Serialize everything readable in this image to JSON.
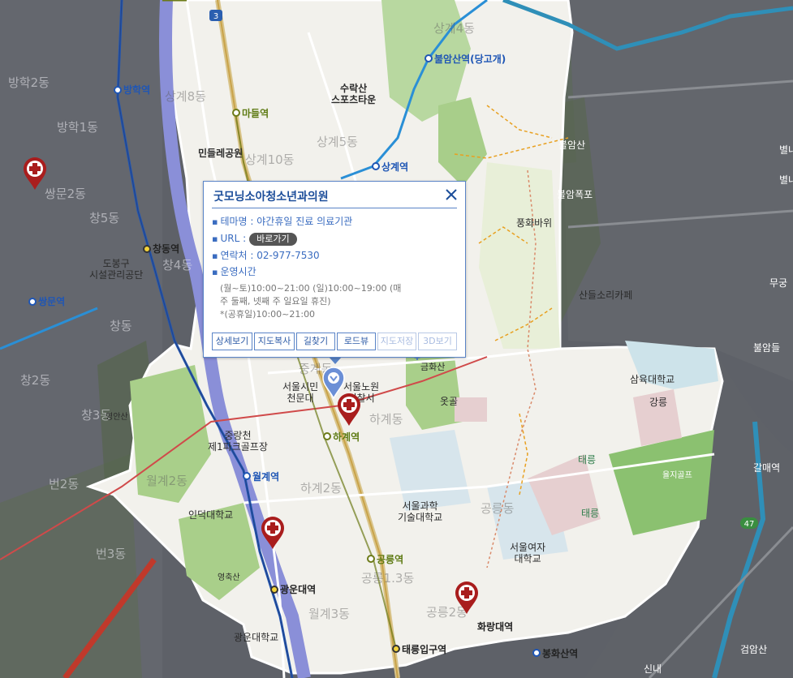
{
  "colors": {
    "outside": "#5e6168",
    "district": "#f3f2ee",
    "park": "#a9cf8a",
    "river": "#8a8fd8",
    "subway1": "#1f56b5",
    "subway7": "#6c7a18",
    "rail": "#c9a34a",
    "hospital": "#a91d1d",
    "popup_border": "#5a84c7"
  },
  "map": {
    "labels_outside": [
      {
        "text": "방학2동"
      },
      {
        "text": "방학1동"
      },
      {
        "text": "쌍문2동"
      },
      {
        "text": "창5동"
      },
      {
        "text": "창4동"
      },
      {
        "text": "창동"
      },
      {
        "text": "창2동"
      },
      {
        "text": "창3동"
      },
      {
        "text": "번2동"
      },
      {
        "text": "번3동"
      },
      {
        "text": "불암폭포"
      },
      {
        "text": "별내"
      },
      {
        "text": "별내"
      },
      {
        "text": "무궁"
      },
      {
        "text": "불암들"
      },
      {
        "text": "갈매역"
      },
      {
        "text": "검암산"
      },
      {
        "text": "불암산"
      },
      {
        "text": "신내"
      }
    ],
    "stations": [
      {
        "text": "방학역"
      },
      {
        "text": "창동역"
      },
      {
        "text": "쌍문역"
      },
      {
        "text": "불암산역(당고개)"
      },
      {
        "text": "상계역"
      },
      {
        "text": "마들역"
      },
      {
        "text": "하계역"
      },
      {
        "text": "월계역"
      },
      {
        "text": "공릉역"
      },
      {
        "text": "광운대역"
      },
      {
        "text": "태릉입구역"
      },
      {
        "text": "화랑대역"
      },
      {
        "text": "봉화산역"
      }
    ],
    "pois": [
      {
        "text": "수락산\n스포츠타운"
      },
      {
        "text": "민들레공원"
      },
      {
        "text": "도봉구\n시설관리공단"
      },
      {
        "text": "서울시민\n천문대"
      },
      {
        "text": "서울노원\n경찰서"
      },
      {
        "text": "중랑천\n제1파크골프장"
      },
      {
        "text": "인덕대학교"
      },
      {
        "text": "서울과학\n기술대학교"
      },
      {
        "text": "서울여자\n대학교"
      },
      {
        "text": "삼육대학교"
      },
      {
        "text": "광운대학교"
      },
      {
        "text": "산들소리카페"
      },
      {
        "text": "풍화바위"
      },
      {
        "text": "금화산"
      },
      {
        "text": "옷골"
      },
      {
        "text": "강릉"
      },
      {
        "text": "태릉"
      },
      {
        "text": "태릉"
      },
      {
        "text": "영축산"
      },
      {
        "text": "영안산"
      },
      {
        "text": "율지골프"
      }
    ],
    "districts": [
      {
        "text": "상계4동"
      },
      {
        "text": "상계8동"
      },
      {
        "text": "상계5동"
      },
      {
        "text": "상계10동"
      },
      {
        "text": "하계동"
      },
      {
        "text": "하계2동"
      },
      {
        "text": "월계2동"
      },
      {
        "text": "월계3동"
      },
      {
        "text": "공릉동"
      },
      {
        "text": "공릉1.3동"
      },
      {
        "text": "공릉2동"
      },
      {
        "text": "중계동"
      }
    ],
    "road_numbers": [
      "3",
      "47"
    ]
  },
  "popup": {
    "title": "굿모닝소아청소년과의원",
    "theme_label": "테마명 : 야간휴일 진료 의료기관",
    "url_label": "URL :",
    "url_button": "바로가기",
    "contact_label": "연락처 : 02-977-7530",
    "hours_label": "운영시간",
    "hours_line1": "(월~토)10:00~21:00 (일)10:00~19:00 (매",
    "hours_line2": "주 둘째, 넷째 주 일요일 휴진)",
    "hours_line3": "*(공휴일)10:00~21:00",
    "buttons": [
      "상세보기",
      "지도복사",
      "길찾기",
      "로드뷰",
      "지도저장",
      "3D보기"
    ]
  }
}
